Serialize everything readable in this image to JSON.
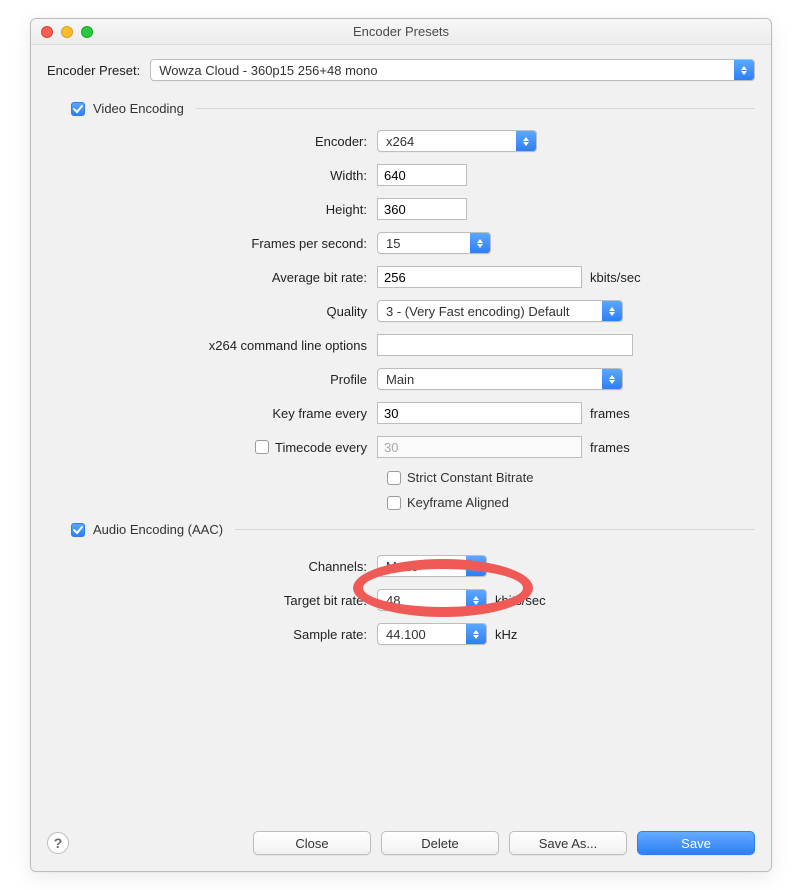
{
  "window": {
    "title": "Encoder Presets"
  },
  "preset": {
    "label": "Encoder Preset:",
    "value": "Wowza Cloud - 360p15 256+48 mono"
  },
  "video": {
    "section_label": "Video Encoding",
    "checked": true,
    "encoder": {
      "label": "Encoder:",
      "value": "x264"
    },
    "width": {
      "label": "Width:",
      "value": "640"
    },
    "height": {
      "label": "Height:",
      "value": "360"
    },
    "fps": {
      "label": "Frames per second:",
      "value": "15"
    },
    "bitrate": {
      "label": "Average bit rate:",
      "value": "256",
      "suffix": "kbits/sec"
    },
    "quality": {
      "label": "Quality",
      "value": "3 - (Very Fast encoding) Default"
    },
    "cmdline": {
      "label": "x264 command line options",
      "value": ""
    },
    "profile": {
      "label": "Profile",
      "value": "Main"
    },
    "keyframe": {
      "label": "Key frame every",
      "value": "30",
      "suffix": "frames"
    },
    "timecode": {
      "label": "Timecode every",
      "value": "30",
      "suffix": "frames",
      "checked": false
    },
    "strict_cbr": {
      "label": "Strict Constant Bitrate",
      "checked": false
    },
    "kf_aligned": {
      "label": "Keyframe Aligned",
      "checked": false
    }
  },
  "audio": {
    "section_label": "Audio Encoding (AAC)",
    "checked": true,
    "channels": {
      "label": "Channels:",
      "value": "Mono"
    },
    "bitrate": {
      "label": "Target bit rate:",
      "value": "48",
      "suffix": "kbits/sec"
    },
    "sample": {
      "label": "Sample rate:",
      "value": "44.100",
      "suffix": "kHz"
    }
  },
  "buttons": {
    "help_tooltip": "?",
    "close": "Close",
    "delete": "Delete",
    "save_as": "Save As...",
    "save": "Save"
  }
}
